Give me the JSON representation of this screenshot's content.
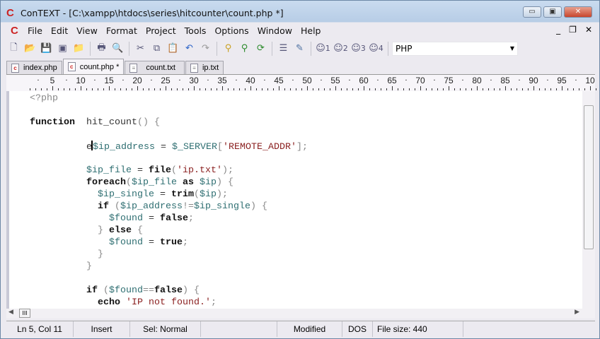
{
  "window": {
    "title": "ConTEXT - [C:\\xampp\\htdocs\\series\\hitcounter\\count.php *]",
    "minimize": "▭",
    "maximize": "▣",
    "close": "✕"
  },
  "menu": {
    "items": [
      "File",
      "Edit",
      "View",
      "Format",
      "Project",
      "Tools",
      "Options",
      "Window",
      "Help"
    ],
    "mdi_min": "_",
    "mdi_restore": "❐",
    "mdi_close": "✕"
  },
  "toolbar": {
    "highlighter": "PHP",
    "user_buttons": [
      "1",
      "2",
      "3",
      "4"
    ]
  },
  "tabs": [
    {
      "label": "index.php"
    },
    {
      "label": "count.php *"
    },
    {
      "label": "count.txt"
    },
    {
      "label": "ip.txt"
    }
  ],
  "ruler": {
    "labels": [
      "5",
      "10",
      "15",
      "20",
      "25",
      "30",
      "35",
      "40",
      "45",
      "50",
      "55",
      "60",
      "65",
      "70",
      "75",
      "80",
      "85",
      "90",
      "95",
      "10"
    ]
  },
  "code": {
    "lines": [
      [
        [
          "p",
          "<?php"
        ]
      ],
      [],
      [
        [
          "k",
          "function"
        ],
        [
          "",
          "  hit_count"
        ],
        [
          "p",
          "() {"
        ]
      ],
      [],
      [
        [
          "",
          "          e"
        ],
        [
          "caret",
          ""
        ],
        [
          "v",
          "$ip_address"
        ],
        [
          "",
          " = "
        ],
        [
          "v",
          "$_SERVER"
        ],
        [
          "p",
          "["
        ],
        [
          "s",
          "'REMOTE_ADDR'"
        ],
        [
          "p",
          "];"
        ]
      ],
      [],
      [
        [
          "",
          "          "
        ],
        [
          "v",
          "$ip_file"
        ],
        [
          "",
          " = "
        ],
        [
          "k",
          "file"
        ],
        [
          "p",
          "("
        ],
        [
          "s",
          "'ip.txt'"
        ],
        [
          "p",
          ");"
        ]
      ],
      [
        [
          "",
          "          "
        ],
        [
          "k",
          "foreach"
        ],
        [
          "p",
          "("
        ],
        [
          "v",
          "$ip_file"
        ],
        [
          "k",
          " as "
        ],
        [
          "v",
          "$ip"
        ],
        [
          "p",
          ") {"
        ]
      ],
      [
        [
          "",
          "            "
        ],
        [
          "v",
          "$ip_single"
        ],
        [
          "",
          " = "
        ],
        [
          "k",
          "trim"
        ],
        [
          "p",
          "("
        ],
        [
          "v",
          "$ip"
        ],
        [
          "p",
          ");"
        ]
      ],
      [
        [
          "",
          "            "
        ],
        [
          "k",
          "if"
        ],
        [
          "p",
          " ("
        ],
        [
          "v",
          "$ip_address"
        ],
        [
          "p",
          "!="
        ],
        [
          "v",
          "$ip_single"
        ],
        [
          "p",
          ") {"
        ]
      ],
      [
        [
          "",
          "              "
        ],
        [
          "v",
          "$found"
        ],
        [
          "",
          " = "
        ],
        [
          "k",
          "false"
        ],
        [
          "p",
          ";"
        ]
      ],
      [
        [
          "",
          "            "
        ],
        [
          "p",
          "} "
        ],
        [
          "k",
          "else"
        ],
        [
          "p",
          " {"
        ]
      ],
      [
        [
          "",
          "              "
        ],
        [
          "v",
          "$found"
        ],
        [
          "",
          " = "
        ],
        [
          "k",
          "true"
        ],
        [
          "p",
          ";"
        ]
      ],
      [
        [
          "",
          "            "
        ],
        [
          "p",
          "}"
        ]
      ],
      [
        [
          "",
          "          "
        ],
        [
          "p",
          "}"
        ]
      ],
      [],
      [
        [
          "",
          "          "
        ],
        [
          "k",
          "if"
        ],
        [
          "p",
          " ("
        ],
        [
          "v",
          "$found"
        ],
        [
          "p",
          "=="
        ],
        [
          "k",
          "false"
        ],
        [
          "p",
          ") {"
        ]
      ],
      [
        [
          "",
          "            "
        ],
        [
          "k",
          "echo"
        ],
        [
          "s",
          " 'IP not found.'"
        ],
        [
          "p",
          ";"
        ]
      ]
    ]
  },
  "status": {
    "position": "Ln 5, Col 11",
    "mode": "Insert",
    "selection": "Sel: Normal",
    "blank": "",
    "modified": "Modified",
    "line_ending": "DOS",
    "file_size": "File size: 440"
  }
}
